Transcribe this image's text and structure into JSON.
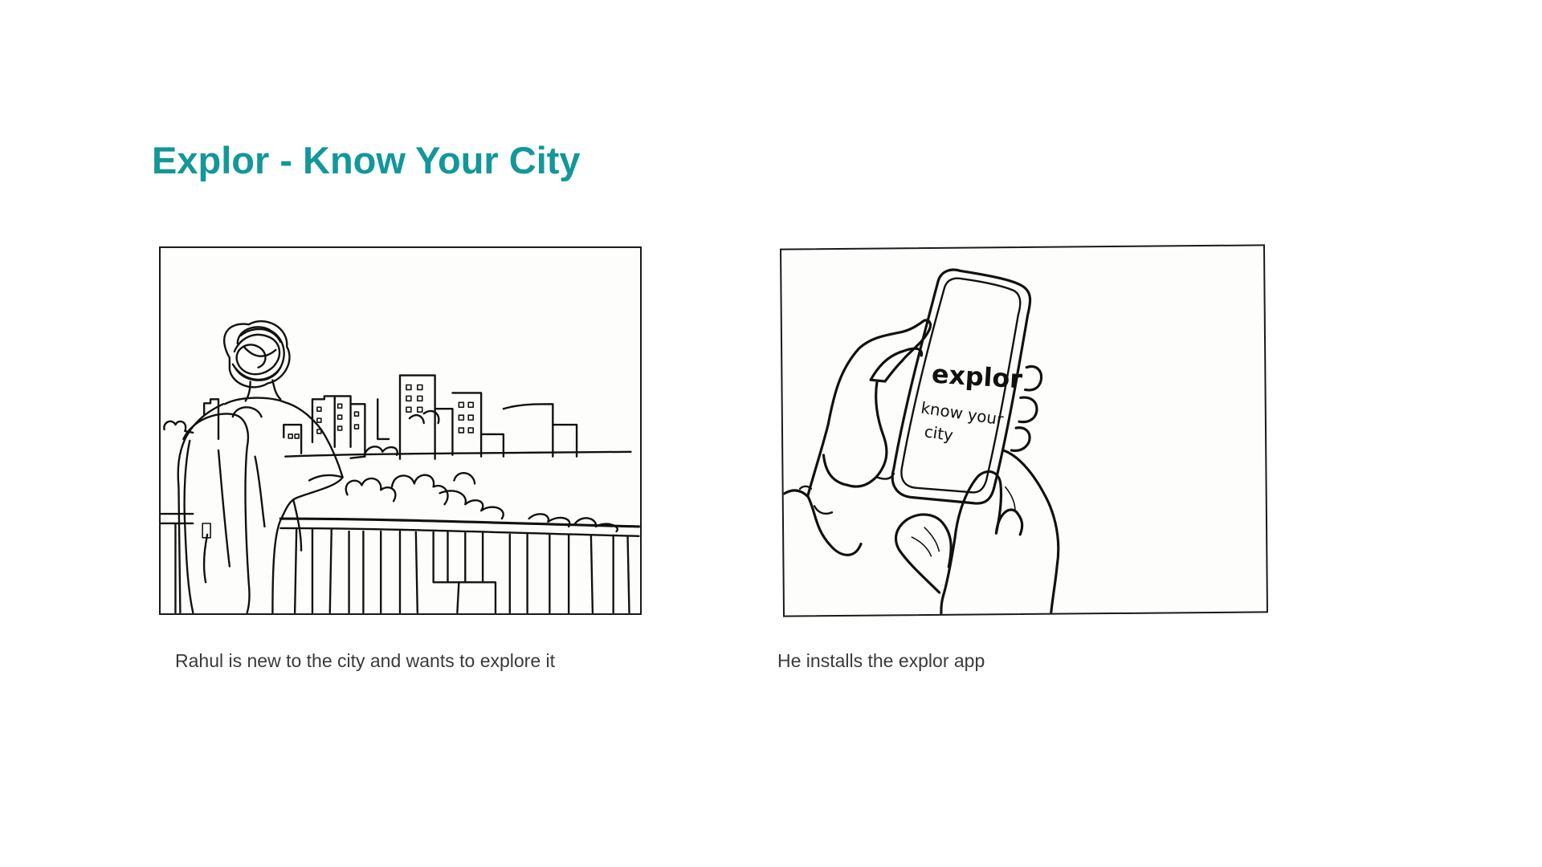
{
  "page": {
    "title": "Explor - Know Your City",
    "accent_color": "#12979a",
    "text_color": "#3a3a3a"
  },
  "panels": [
    {
      "illustration": "sketch-man-overlooking-city",
      "caption": "Rahul is new to the city and wants to explore it"
    },
    {
      "illustration": "sketch-hands-holding-phone",
      "screen_app_name": "explor",
      "screen_tagline_line1": "know your",
      "screen_tagline_line2": "city",
      "caption": "He installs the explor app"
    }
  ]
}
